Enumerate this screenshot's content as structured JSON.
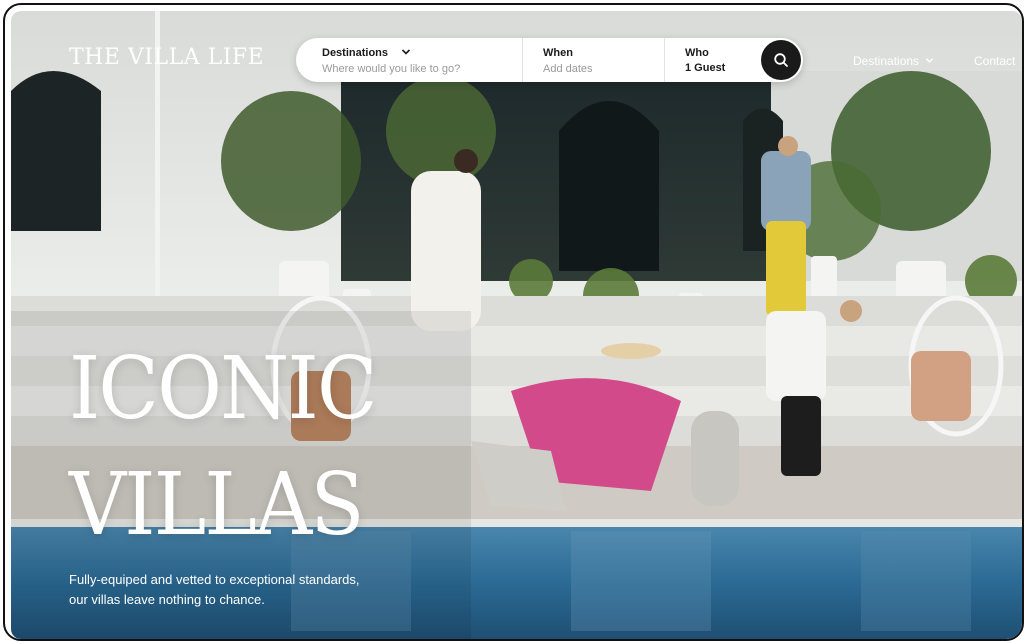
{
  "brand": {
    "logo_text": "THE VILLA LIFE"
  },
  "search": {
    "destinations_label": "Destinations",
    "destinations_placeholder": "Where would you like to go?",
    "when_label": "When",
    "when_placeholder": "Add dates",
    "who_label": "Who",
    "who_value": "1 Guest",
    "search_icon": "search-icon"
  },
  "nav": {
    "destinations_label": "Destinations",
    "contact_label": "Contact"
  },
  "hero": {
    "headline_line1": "ICONIC",
    "headline_line2": "VILLAS",
    "subtext_line1": "Fully-equiped and vetted to exceptional standards,",
    "subtext_line2": "our villas leave nothing to chance."
  },
  "colors": {
    "sky": "#cfd2d0",
    "villa_wall": "#e9ebe8",
    "terrace": "#c9c7c2",
    "pool": "#2e6f99",
    "foliage": "#3d5a2c",
    "search_button": "#1a1a1a"
  }
}
